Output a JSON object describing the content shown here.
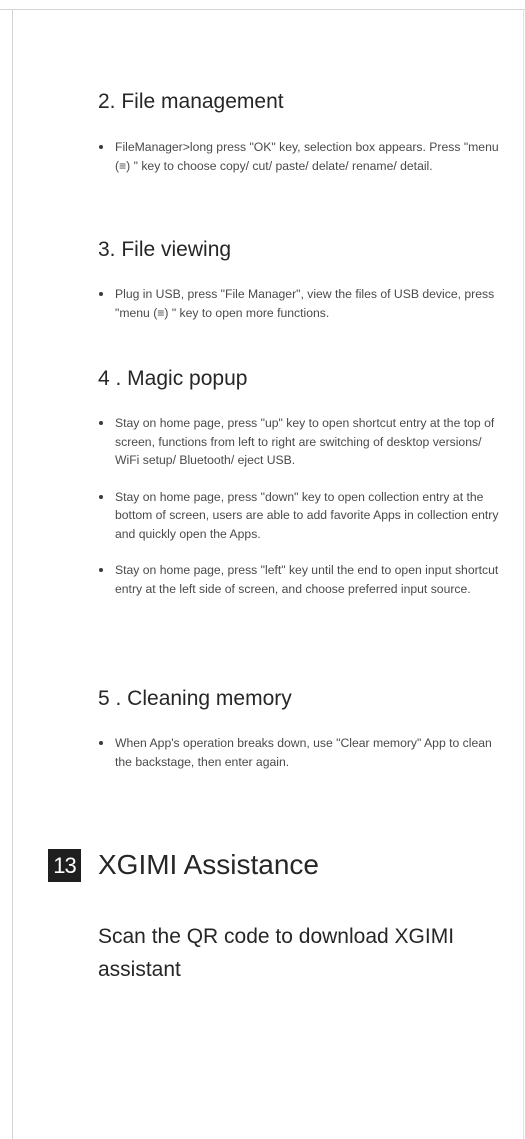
{
  "sections": [
    {
      "heading": "2. File management",
      "bullets": [
        "FileManager>long press \"OK\" key, selection box appears. Press \"menu (≡) \" key to choose copy/ cut/ paste/ delate/ rename/ detail."
      ]
    },
    {
      "heading": "3. File viewing",
      "bullets": [
        "Plug in USB, press \"File Manager\", view the files of USB device, press \"menu (≡) \" key to open more functions."
      ]
    },
    {
      "heading": "4 . Magic popup",
      "bullets": [
        "Stay on home page, press \"up\" key to open shortcut entry at the top of screen, functions from left to right are switching of desktop versions/ WiFi setup/ Bluetooth/ eject USB.",
        "Stay on home page, press \"down\" key to open collection entry at the bottom of screen, users are able to add favorite Apps in collection entry and quickly open the Apps.",
        "Stay on home page, press \"left\" key until the end to open input shortcut entry at the left side of screen, and choose preferred input source."
      ]
    },
    {
      "heading": "5 . Cleaning memory",
      "bullets": [
        "When App's operation breaks down, use \"Clear memory\" App to clean the backstage, then enter again."
      ]
    }
  ],
  "chapter": {
    "number": "13",
    "title": "XGIMI Assistance"
  },
  "scan_text": "Scan the QR code to download XGIMI assistant"
}
